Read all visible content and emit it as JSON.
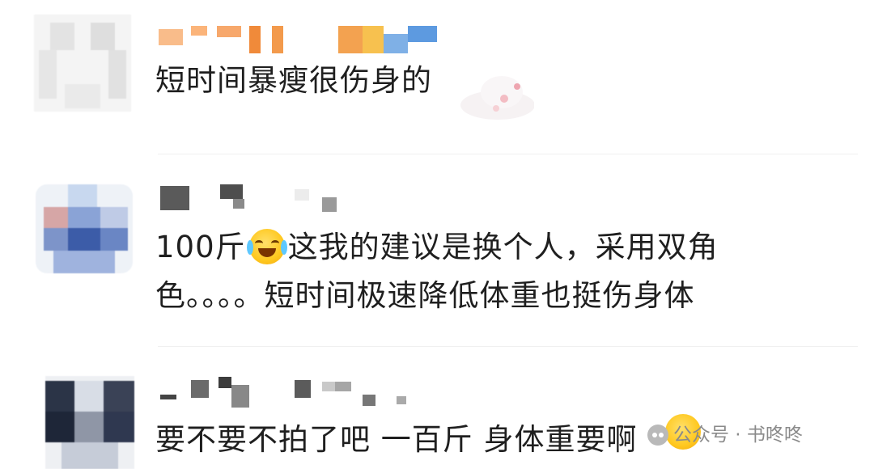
{
  "comments": [
    {
      "text": "短时间暴瘦很伤身的"
    },
    {
      "line1_prefix": "100斤",
      "emoji": "laugh-cry-emoji",
      "line1_suffix": "这我的建议是换个人，采用双角",
      "line2": "色。。。。短时间极速降低体重也挺伤身体"
    },
    {
      "text": "要不要不拍了吧 一百斤 身体重要啊"
    }
  ],
  "watermark": {
    "text": "公众号 · 书咚咚"
  },
  "colors": {
    "text": "#1f1f1f",
    "watermark": "#8a8a8a",
    "emoji": "#ffc81f"
  }
}
